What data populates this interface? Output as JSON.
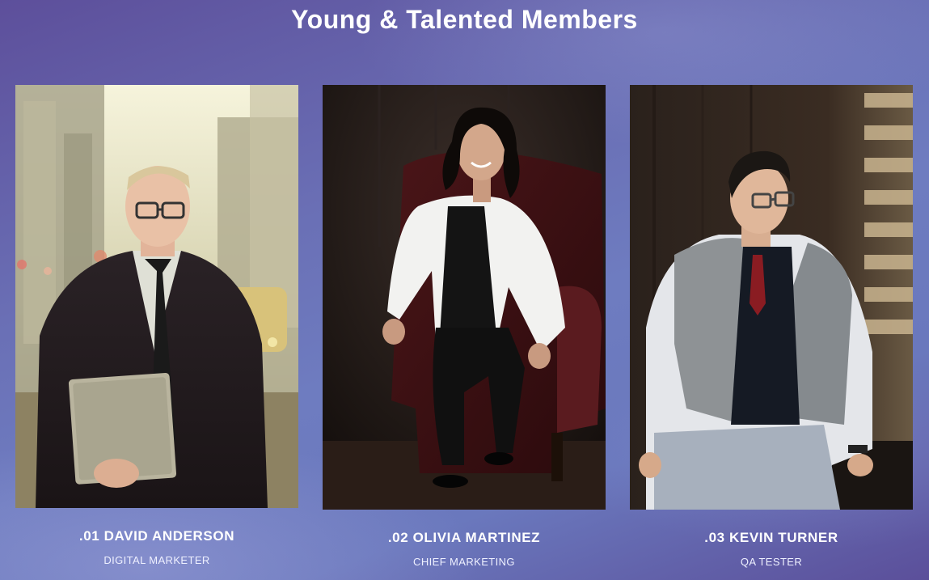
{
  "section": {
    "title": "Young & Talented Members"
  },
  "members": [
    {
      "name": ".01 DAVID ANDERSON",
      "role": "DIGITAL MARKETER",
      "photo_icon": "photo-man-street-laptop"
    },
    {
      "name": ".02 OLIVIA MARTINEZ",
      "role": "CHIEF MARKETING",
      "photo_icon": "photo-woman-leather-chair"
    },
    {
      "name": ".03 KEVIN TURNER",
      "role": "QA TESTER",
      "photo_icon": "photo-man-grey-vest"
    }
  ],
  "colors": {
    "background_start": "#5d4f9b",
    "background_mid": "#6e7cc0",
    "text": "#ffffff"
  }
}
